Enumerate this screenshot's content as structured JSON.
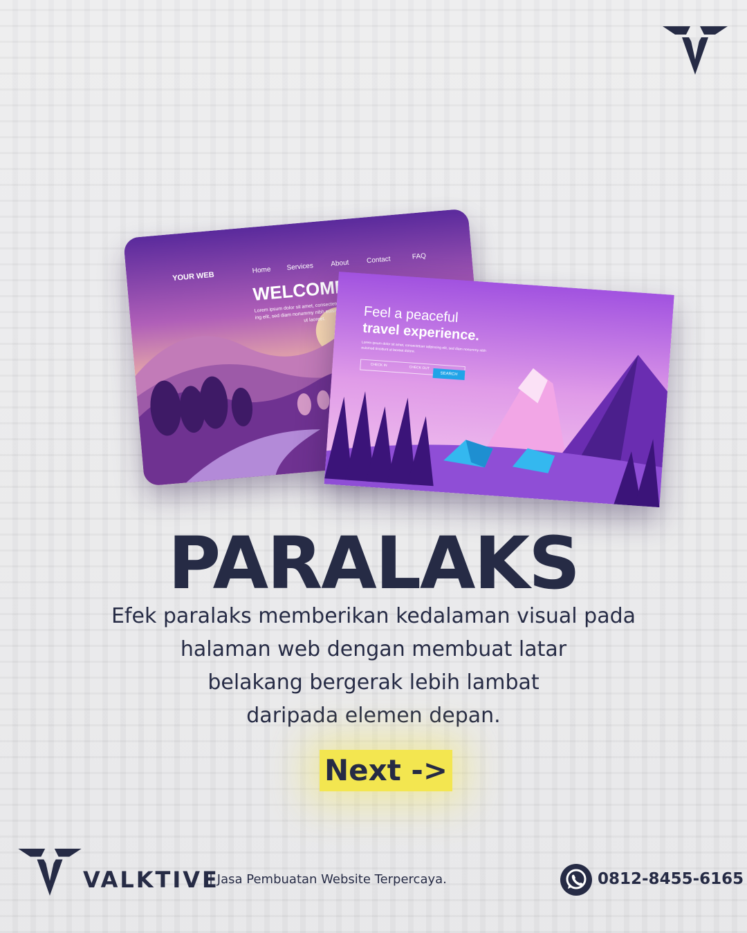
{
  "mockup_back": {
    "brand": "YOUR WEB",
    "nav": [
      "Home",
      "Services",
      "About",
      "Contact",
      "FAQ"
    ],
    "hero_title": "WELCOME",
    "hero_text_1": "Lorem ipsum dolor sit amet, consectetuer",
    "hero_text_2": "ing elit, sed diam nonummy nibh euismod",
    "hero_text_3": "ut laoreet."
  },
  "mockup_front": {
    "title_line1": "Feel a peaceful",
    "title_line2": "travel experience.",
    "body_text": "Lorem ipsum dolor sit amet, consectetuer adipiscing elit, sed diam nonummy nibh euismod tincidunt ut laoreet dolore.",
    "check_in": "CHECK IN",
    "check_out": "CHECK OUT",
    "search_label": "SEARCH"
  },
  "headline": "PARALAKS",
  "description": {
    "line1": "Efek paralaks memberikan kedalaman visual pada",
    "line2": "halaman web dengan membuat latar",
    "line3": "belakang bergerak lebih lambat",
    "line4": "daripada elemen depan."
  },
  "next_label": "Next ->",
  "footer": {
    "brand": "VALKTIVE",
    "tagline": "| Jasa Pembuatan Website Terpercaya.",
    "phone": "0812-8455-6165"
  },
  "colors": {
    "navy": "#262b45",
    "yellow": "#f3e650",
    "purple": "#7b3fc7",
    "pink": "#f2a6e6"
  },
  "icons": [
    "valktive-logo-icon",
    "whatsapp-icon"
  ]
}
